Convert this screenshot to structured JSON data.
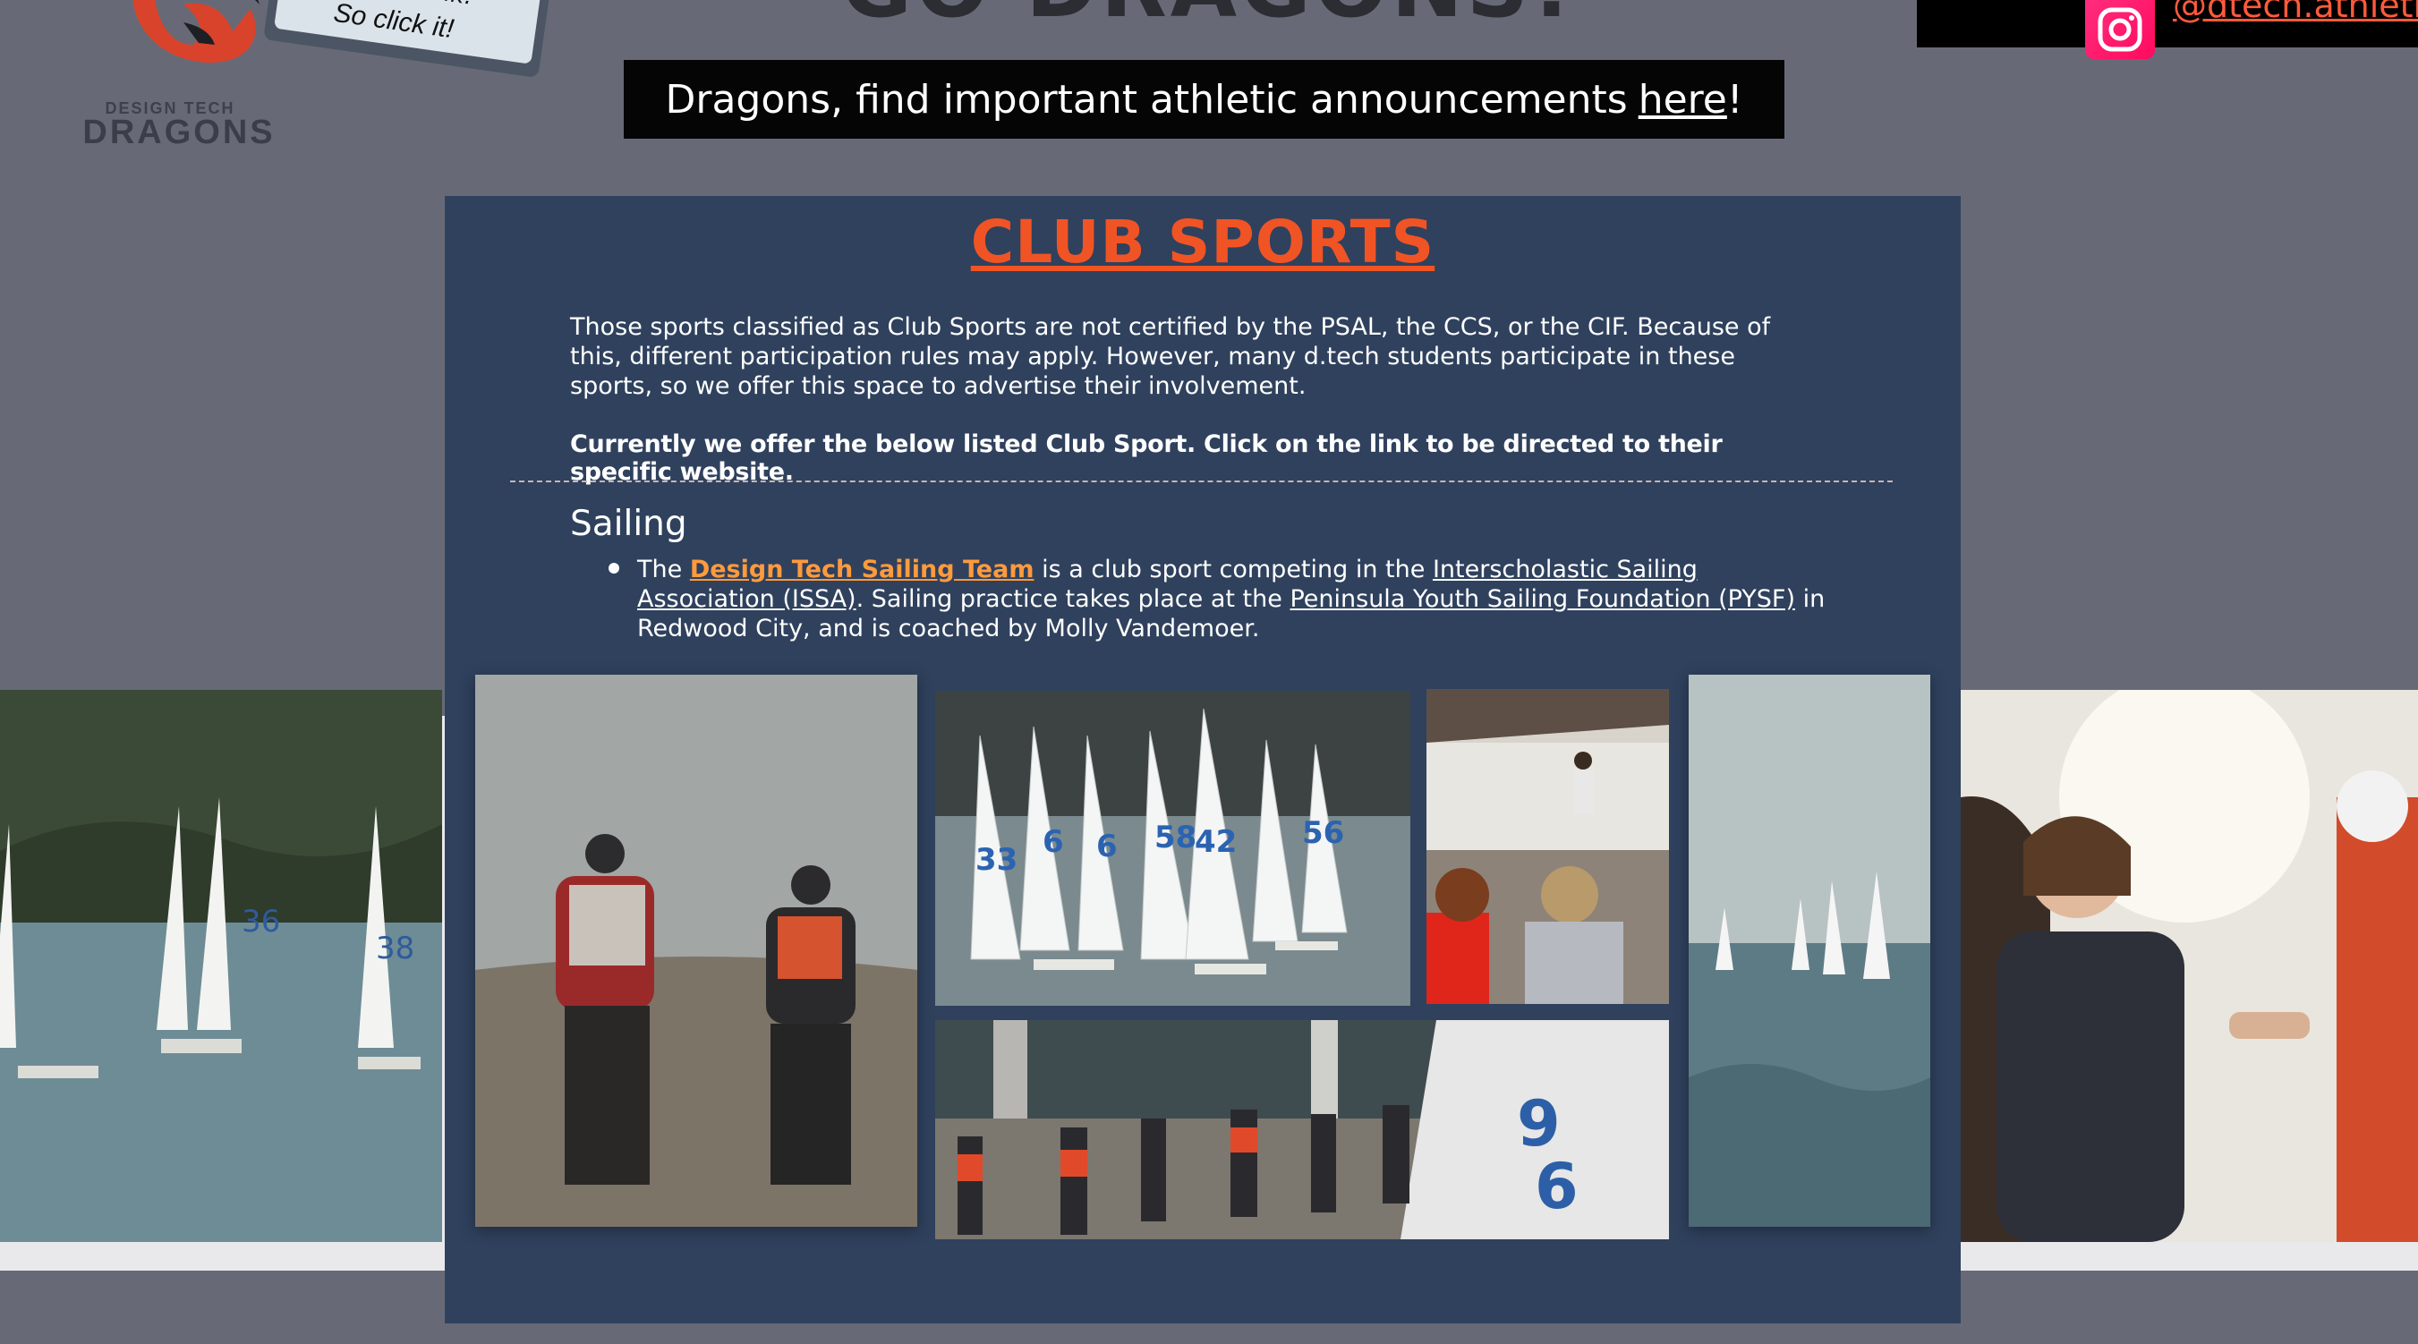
{
  "header": {
    "logo_sub": "DESIGN TECH",
    "logo_main": "DRAGONS",
    "bubble_top": "link!",
    "bubble_text": "So click it!",
    "go_dragons": "GO DRAGONS!",
    "announcement_prefix": "Dragons, find important athletic announcements",
    "announcement_link": "here",
    "announcement_suffix": "!",
    "instagram_handle": "@dtech.athletics",
    "instagram_color": "#ff1f6e"
  },
  "section": {
    "title": "CLUB SPORTS",
    "title_color": "#f05424",
    "intro": "Those sports classified as Club Sports are not certified by the PSAL, the CCS, or the CIF. Because of this, different participation rules may apply. However, many d.tech students participate in these sports, so we offer this space to advertise their involvement.",
    "offer": "Currently we offer the below listed Club Sport.  Click on the link to be directed to their specific website."
  },
  "sailing": {
    "heading": "Sailing",
    "text_1": "The",
    "team_link": "Design Tech Sailing Team",
    "text_2": "is a club sport competing in the",
    "issa_link": "Interscholastic Sailing Association (ISSA)",
    "text_3": ".  Sailing practice takes place at the",
    "pysf_link": "Peninsula Youth Sailing Foundation (PYSF)",
    "text_4": "in Redwood City, and is coached by Molly Vandemoer."
  },
  "gallery": [
    {
      "name": "photo-sailboats-left"
    },
    {
      "name": "photo-sailors-beach"
    },
    {
      "name": "photo-fleet-racing"
    },
    {
      "name": "photo-classroom-briefing"
    },
    {
      "name": "photo-boats-water"
    },
    {
      "name": "photo-team-walking"
    },
    {
      "name": "photo-coach-smiling"
    }
  ],
  "sail_numbers": [
    "33",
    "6",
    "6",
    "58",
    "42",
    "56",
    "36",
    "38",
    "9",
    "6"
  ]
}
